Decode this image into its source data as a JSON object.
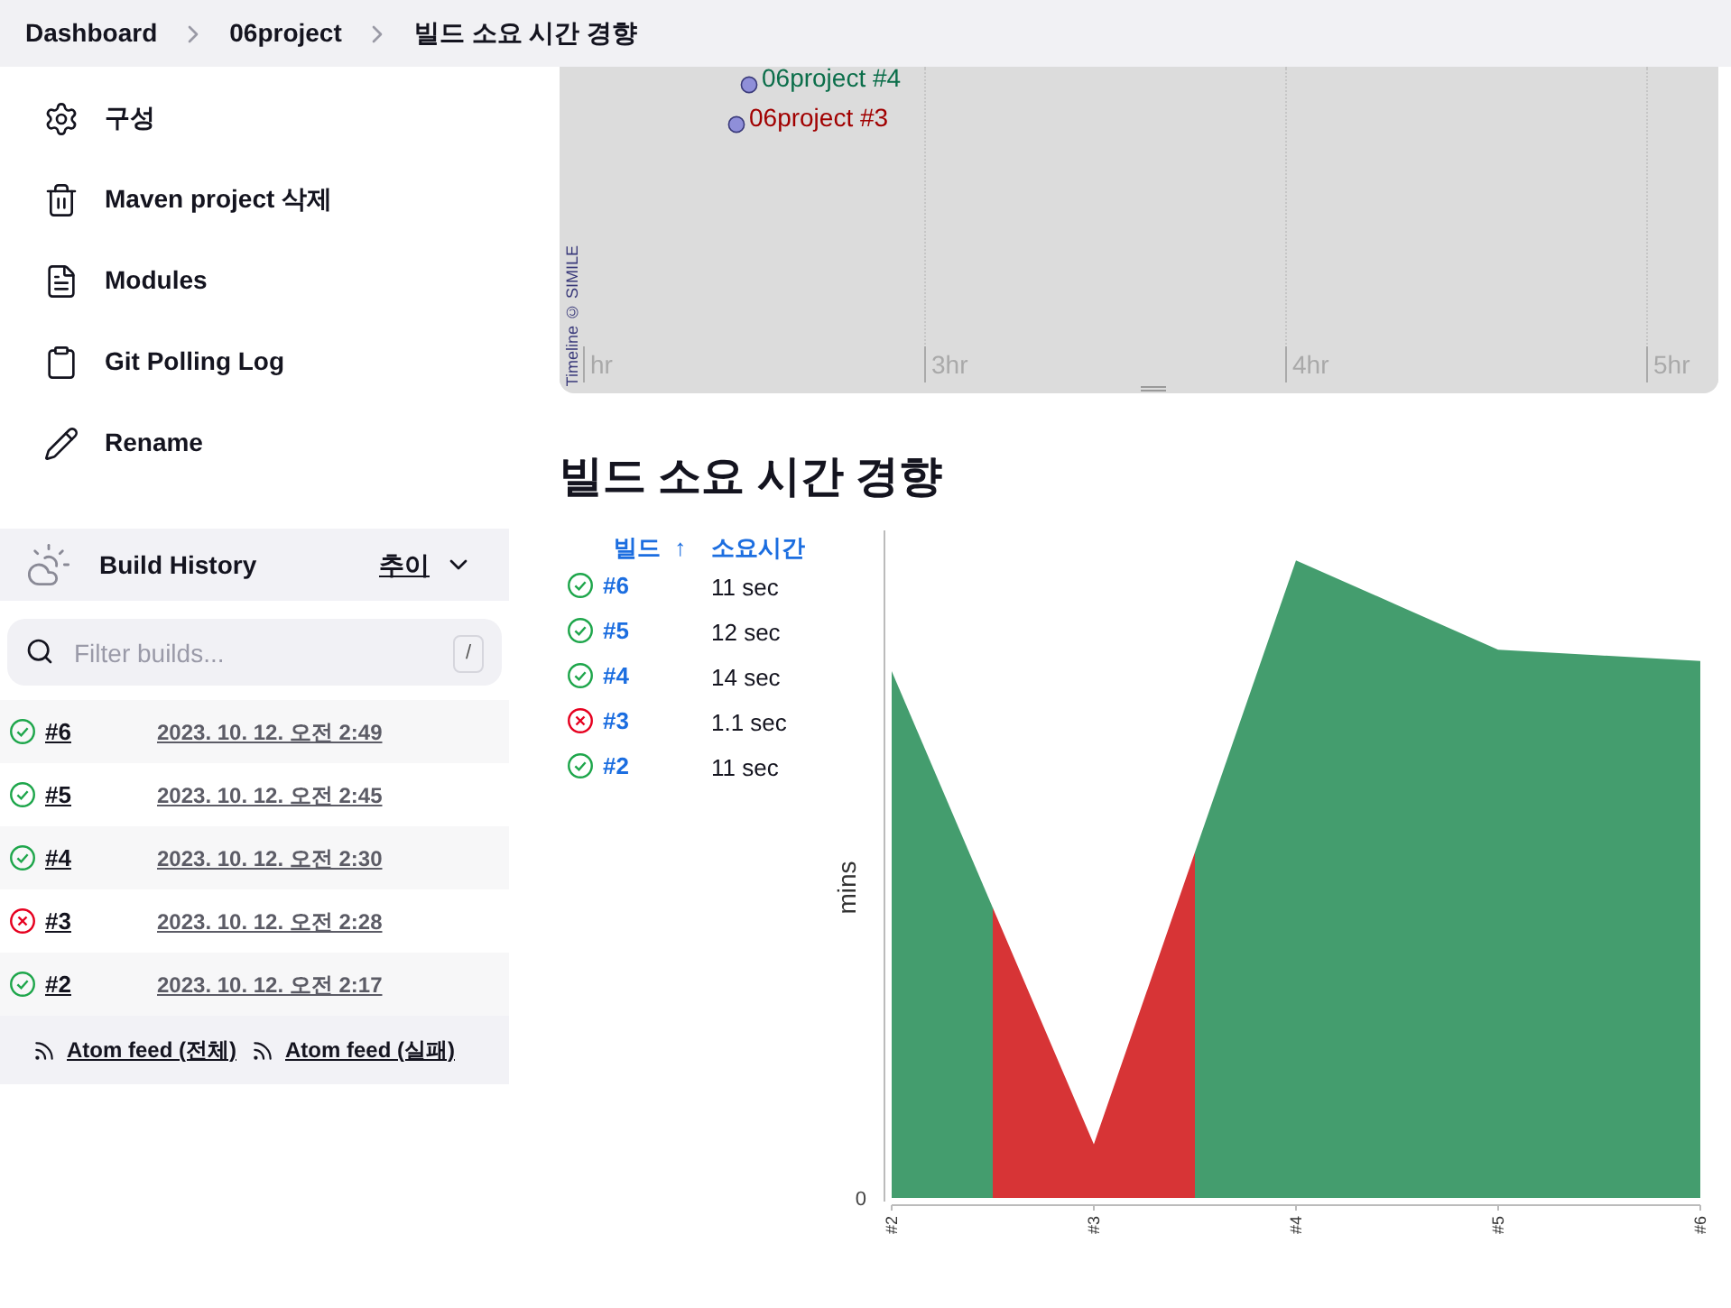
{
  "breadcrumbs": [
    "Dashboard",
    "06project",
    "빌드 소요 시간 경향"
  ],
  "sidebar": {
    "items": [
      {
        "label": "구성"
      },
      {
        "label": "Maven project 삭제"
      },
      {
        "label": "Modules"
      },
      {
        "label": "Git Polling Log"
      },
      {
        "label": "Rename"
      }
    ]
  },
  "timeline": {
    "events": [
      {
        "label": "06project #4",
        "failed": false
      },
      {
        "label": "06project #3",
        "failed": true
      }
    ],
    "scale_labels": [
      "hr",
      "3hr",
      "4hr",
      "5hr"
    ],
    "credit": "Timeline © SIMILE"
  },
  "build_history": {
    "title": "Build History",
    "trend_link": "추이",
    "filter": {
      "placeholder": "Filter builds...",
      "shortcut": "/"
    },
    "builds": [
      {
        "number": "#6",
        "date": "2023. 10. 12. 오전 2:49",
        "failed": false
      },
      {
        "number": "#5",
        "date": "2023. 10. 12. 오전 2:45",
        "failed": false
      },
      {
        "number": "#4",
        "date": "2023. 10. 12. 오전 2:30",
        "failed": false
      },
      {
        "number": "#3",
        "date": "2023. 10. 12. 오전 2:28",
        "failed": true
      },
      {
        "number": "#2",
        "date": "2023. 10. 12. 오전 2:17",
        "failed": false
      }
    ],
    "feeds": [
      "Atom feed (전체)",
      "Atom feed (실패)"
    ]
  },
  "heading": "빌드 소요 시간 경향",
  "duration_table": {
    "columns": [
      {
        "label": "빌드",
        "sort": "↑"
      },
      {
        "label": "소요시간"
      }
    ],
    "rows": [
      {
        "failed": false,
        "build": "#6",
        "duration": "11 sec"
      },
      {
        "failed": false,
        "build": "#5",
        "duration": "12 sec"
      },
      {
        "failed": false,
        "build": "#4",
        "duration": "14 sec"
      },
      {
        "failed": true,
        "build": "#3",
        "duration": "1.1 sec"
      },
      {
        "failed": false,
        "build": "#2",
        "duration": "11 sec"
      }
    ]
  },
  "trend_chart": {
    "ylabel": "mins",
    "ytick": "0",
    "points": [
      {
        "label": "#2",
        "failed": false
      },
      {
        "label": "#3",
        "failed": true
      },
      {
        "label": "#4",
        "failed": false
      },
      {
        "label": "#5",
        "failed": false
      },
      {
        "label": "#6",
        "failed": false
      }
    ]
  }
}
